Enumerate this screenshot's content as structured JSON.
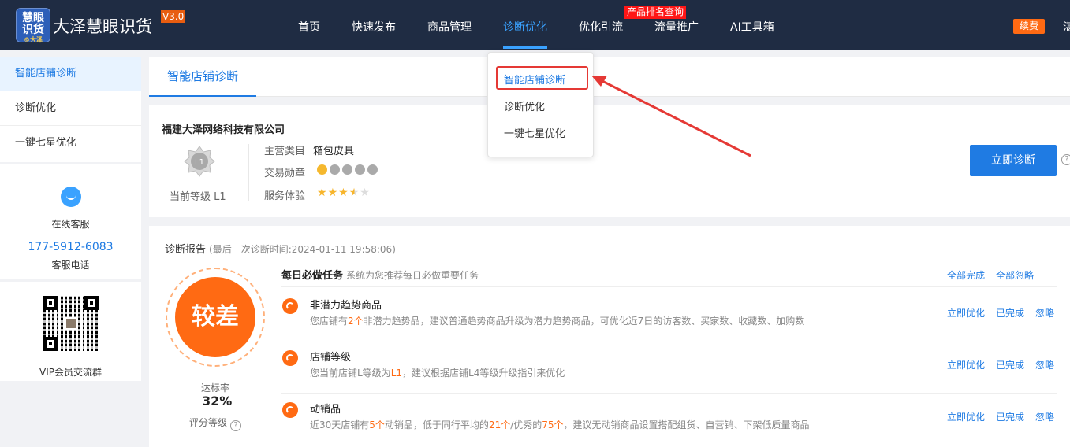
{
  "app": {
    "logo_line1": "慧眼",
    "logo_line2": "识货",
    "logo_sub": "©大泽",
    "name": "大泽慧眼识货",
    "version": "V3.0"
  },
  "nav": {
    "items": [
      "首页",
      "快速发布",
      "商品管理",
      "诊断优化",
      "优化引流",
      "流量推广",
      "AI工具箱"
    ],
    "active": "诊断优化",
    "hot_badge": "产品排名查询",
    "renew": "续费",
    "cut_text": "湛"
  },
  "dropdown": {
    "items": [
      "智能店铺诊断",
      "诊断优化",
      "一键七星优化"
    ]
  },
  "sidebar": {
    "items": [
      "智能店铺诊断",
      "诊断优化",
      "一键七星优化"
    ],
    "service_label": "在线客服",
    "phone": "177-5912-6083",
    "phone_label": "客服电话",
    "qr_label": "VIP会员交流群"
  },
  "tab": {
    "label": "智能店铺诊断"
  },
  "company": {
    "name": "福建大泽网络科技有限公司",
    "level": "当前等级 L1",
    "medal_text": "L1",
    "category_label": "主营类目",
    "category_value": "箱包皮具",
    "medal_label": "交易勋章",
    "service_label": "服务体验",
    "rating": 3.5,
    "rating_max": 5,
    "diagnose_button": "立即诊断",
    "help": "?"
  },
  "report": {
    "title": "诊断报告",
    "time": "(最后一次诊断时间:2024-01-11 19:58:06)",
    "score_text": "较差",
    "rate_label": "达标率",
    "rate_value": "32%",
    "grade_label": "评分等级",
    "help": "?",
    "daily_title": "每日必做任务",
    "daily_sub": "系统为您推荐每日必做重要任务",
    "complete_all": "全部完成",
    "ignore_all": "全部忽略",
    "actions": {
      "optimize": "立即优化",
      "done": "已完成",
      "ignore": "忽略"
    },
    "tasks": [
      {
        "title": "非潜力趋势商品",
        "desc_a": "您店铺有",
        "desc_h1": "2个",
        "desc_b": "非潜力趋势品，建议普通趋势商品升级为潜力趋势商品，可优化近7日的访客数、买家数、收藏数、加购数"
      },
      {
        "title": "店铺等级",
        "desc_a": "您当前店铺L等级为",
        "desc_h1": "L1",
        "desc_b": "，建议根据店铺L4等级升级指引来优化"
      },
      {
        "title": "动销品",
        "desc_a": "近30天店铺有",
        "desc_h1": "5个",
        "desc_b": "动销品，低于同行平均的",
        "desc_h2": "21个",
        "desc_c": "/优秀的",
        "desc_h3": "75个",
        "desc_d": "，建议无动销商品设置搭配组货、自营销、下架低质量商品"
      }
    ]
  },
  "colors": {
    "topbar": "#1f2c43",
    "accent": "#1f7be3",
    "warning": "#ff6a13",
    "annotation": "#e53935"
  }
}
